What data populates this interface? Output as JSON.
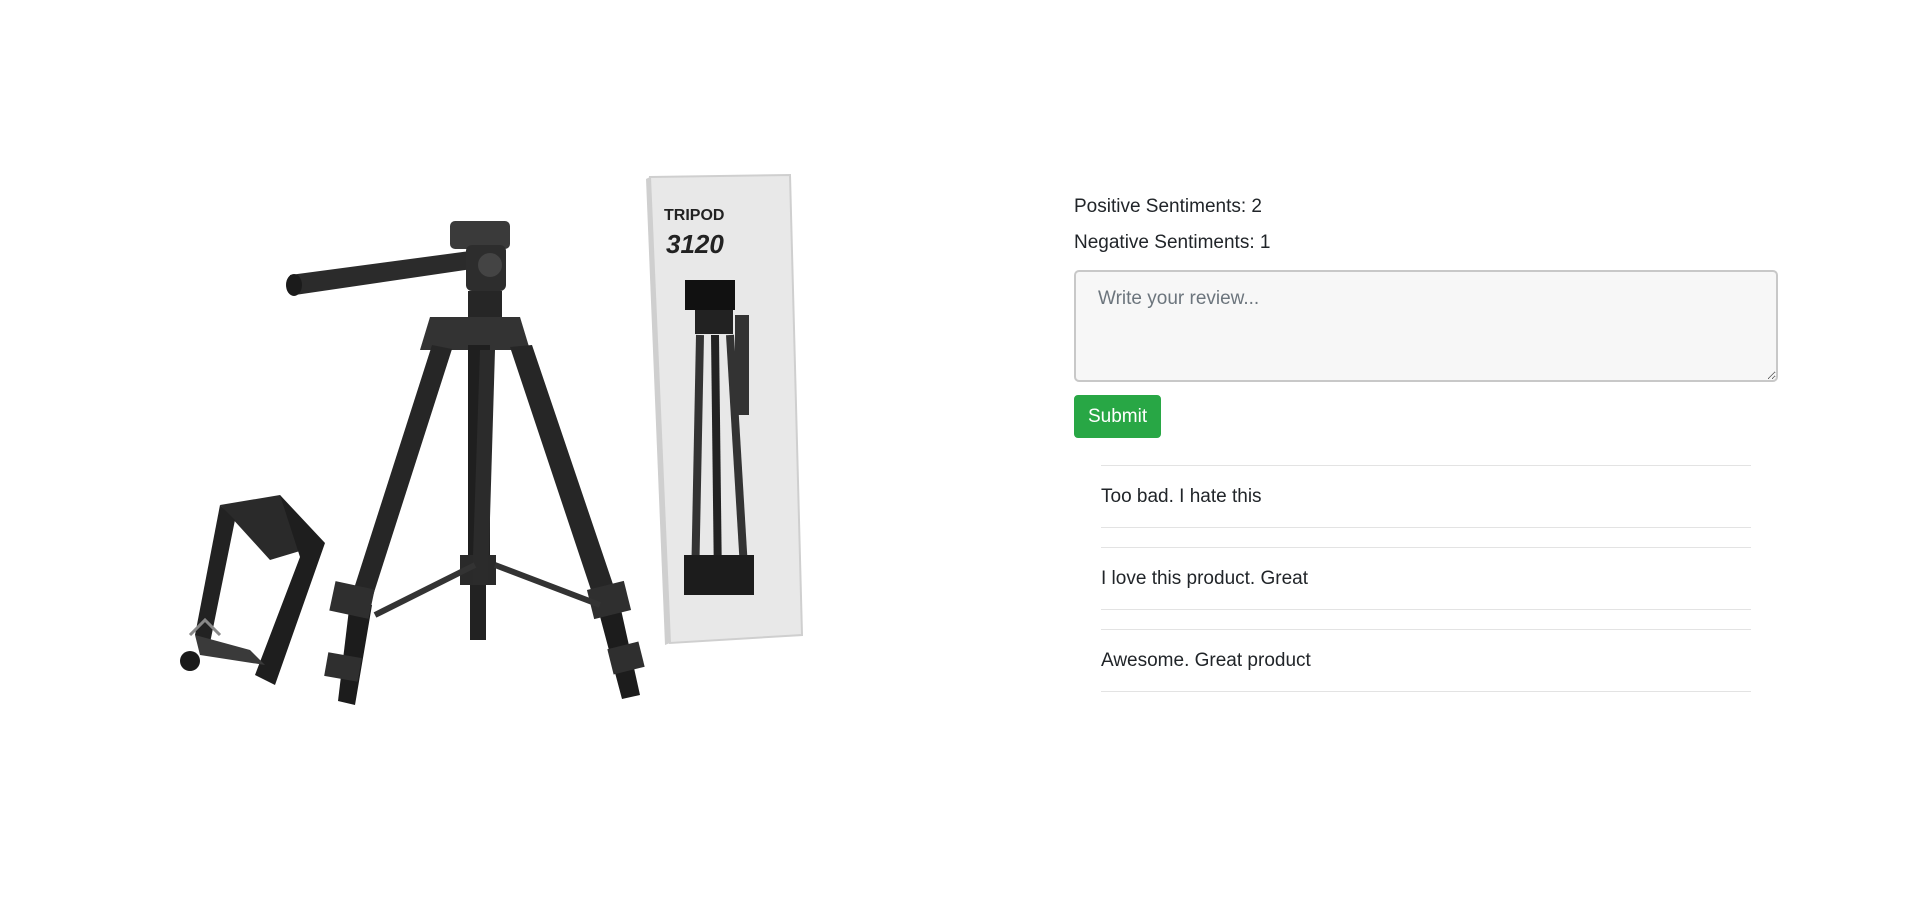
{
  "product": {
    "image_icon": "tripod-product-image",
    "box_brand": "TRIPOD",
    "box_model": "3120"
  },
  "sentiments": {
    "positive_label": "Positive Sentiments:",
    "positive_count": "2",
    "negative_label": "Negative Sentiments:",
    "negative_count": "1"
  },
  "review_form": {
    "placeholder": "Write your review...",
    "value": "",
    "submit_label": "Submit",
    "submit_color": "#28a745"
  },
  "reviews": [
    {
      "text": "Too bad. I hate this"
    },
    {
      "text": "I love this product. Great"
    },
    {
      "text": "Awesome. Great product"
    }
  ]
}
